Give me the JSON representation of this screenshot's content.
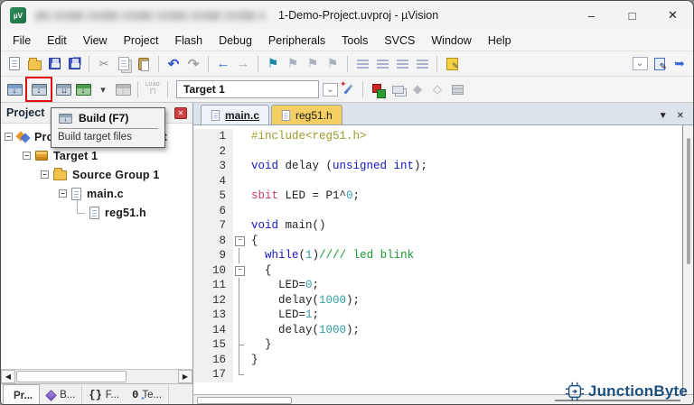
{
  "window": {
    "title": "1-Demo-Project.uvproj - µVision",
    "controls": [
      {
        "name": "minimize",
        "glyph": "–"
      },
      {
        "name": "maximize",
        "glyph": "□"
      },
      {
        "name": "close",
        "glyph": "✕"
      }
    ]
  },
  "menu": {
    "items": [
      "File",
      "Edit",
      "View",
      "Project",
      "Flash",
      "Debug",
      "Peripherals",
      "Tools",
      "SVCS",
      "Window",
      "Help"
    ]
  },
  "toolbar_file": {
    "groups": [
      [
        "new-file",
        "open-folder",
        "save",
        "save-all"
      ],
      [
        "cut",
        "copy",
        "paste"
      ],
      [
        "undo",
        "redo"
      ],
      [
        "nav-back",
        "nav-forward"
      ],
      [
        "bookmark",
        "bookmark-prev",
        "bookmark-next",
        "bookmark-clear"
      ],
      [
        "indent",
        "unindent",
        "comment",
        "uncomment"
      ],
      [
        "configure"
      ]
    ],
    "right": [
      "find-dropdown",
      "edit-document",
      "help-arrow"
    ]
  },
  "toolbar_build": {
    "items": [
      "translate",
      "build",
      "rebuild",
      "batch-build",
      "batch-caret",
      "stop-build",
      "sep",
      "load",
      "sep",
      "target-select",
      "target-dropdown",
      "options-wand",
      "sep",
      "manage-items",
      "file-layers",
      "diamond",
      "diamond-outline",
      "pack-installer"
    ],
    "target": "Target 1",
    "load_label": "LOAD"
  },
  "tooltip": {
    "title": "Build (F7)",
    "subtitle": "Build target files"
  },
  "project_panel": {
    "header": "Project",
    "tree": [
      {
        "label": "Project: 1-Demo-Project",
        "icon": "workspace",
        "expander": "minus",
        "indent": 0
      },
      {
        "label": "Target 1",
        "icon": "target",
        "expander": "minus",
        "indent": 1
      },
      {
        "label": "Source Group 1",
        "icon": "folder",
        "expander": "minus",
        "indent": 2
      },
      {
        "label": "main.c",
        "icon": "file",
        "expander": "minus",
        "indent": 3
      },
      {
        "label": "reg51.h",
        "icon": "file",
        "expander": "none",
        "indent": 4
      }
    ]
  },
  "editor": {
    "tabs": [
      {
        "label": "main.c",
        "active": true,
        "modified": false
      },
      {
        "label": "reg51.h",
        "active": false,
        "modified": true
      }
    ],
    "lines": [
      {
        "n": 1,
        "fold": "",
        "segs": [
          [
            "#include<reg51.h>",
            "pre"
          ]
        ]
      },
      {
        "n": 2,
        "fold": "",
        "segs": []
      },
      {
        "n": 3,
        "fold": "",
        "segs": [
          [
            "void",
            "kw"
          ],
          [
            " delay (",
            "pl"
          ],
          [
            "unsigned int",
            "kw"
          ],
          [
            ");",
            "pl"
          ]
        ]
      },
      {
        "n": 4,
        "fold": "",
        "segs": []
      },
      {
        "n": 5,
        "fold": "",
        "segs": [
          [
            "sbit",
            "sbit"
          ],
          [
            " LED = P1^",
            "pl"
          ],
          [
            "0",
            "num"
          ],
          [
            ";",
            "pl"
          ]
        ]
      },
      {
        "n": 6,
        "fold": "",
        "segs": []
      },
      {
        "n": 7,
        "fold": "",
        "segs": [
          [
            "void",
            "kw"
          ],
          [
            " main()",
            "pl"
          ]
        ]
      },
      {
        "n": 8,
        "fold": "box",
        "segs": [
          [
            "{",
            "pl"
          ]
        ]
      },
      {
        "n": 9,
        "fold": "line",
        "segs": [
          [
            "  ",
            "pl"
          ],
          [
            "while",
            "kw"
          ],
          [
            "(",
            "pl"
          ],
          [
            "1",
            "num"
          ],
          [
            ")",
            "pl"
          ],
          [
            "//// led blink",
            "com"
          ]
        ]
      },
      {
        "n": 10,
        "fold": "box",
        "segs": [
          [
            "  {",
            "pl"
          ]
        ]
      },
      {
        "n": 11,
        "fold": "line",
        "segs": [
          [
            "    LED=",
            "pl"
          ],
          [
            "0",
            "num"
          ],
          [
            ";",
            "pl"
          ]
        ]
      },
      {
        "n": 12,
        "fold": "line",
        "segs": [
          [
            "    delay(",
            "pl"
          ],
          [
            "1000",
            "num"
          ],
          [
            ");",
            "pl"
          ]
        ]
      },
      {
        "n": 13,
        "fold": "line",
        "segs": [
          [
            "    LED=",
            "pl"
          ],
          [
            "1",
            "num"
          ],
          [
            ";",
            "pl"
          ]
        ]
      },
      {
        "n": 14,
        "fold": "line",
        "segs": [
          [
            "    delay(",
            "pl"
          ],
          [
            "1000",
            "num"
          ],
          [
            ");",
            "pl"
          ]
        ]
      },
      {
        "n": 15,
        "fold": "tick",
        "segs": [
          [
            "  }",
            "pl"
          ]
        ]
      },
      {
        "n": 16,
        "fold": "line",
        "segs": [
          [
            "}",
            "pl"
          ]
        ]
      },
      {
        "n": 17,
        "fold": "end",
        "segs": []
      }
    ]
  },
  "bottom_tabs": [
    {
      "icon": "project-tab",
      "label": "Pr...",
      "active": true,
      "sep": false
    },
    {
      "icon": "books",
      "label": "B...",
      "active": false,
      "sep": true
    },
    {
      "icon": "functions",
      "label": "F...",
      "active": false,
      "icon_text": "{}",
      "sep": false
    },
    {
      "icon": "templates",
      "label": "Te...",
      "active": false,
      "icon_text": "0",
      "sep": true
    }
  ],
  "scroll": {
    "left_arrow": "◀",
    "right_arrow": "▶",
    "tab_overflow": "▼",
    "tab_close": "✕",
    "combo_chevron": "⌄"
  },
  "brand": {
    "name": "JunctionByte",
    "color": "#1b5081"
  }
}
